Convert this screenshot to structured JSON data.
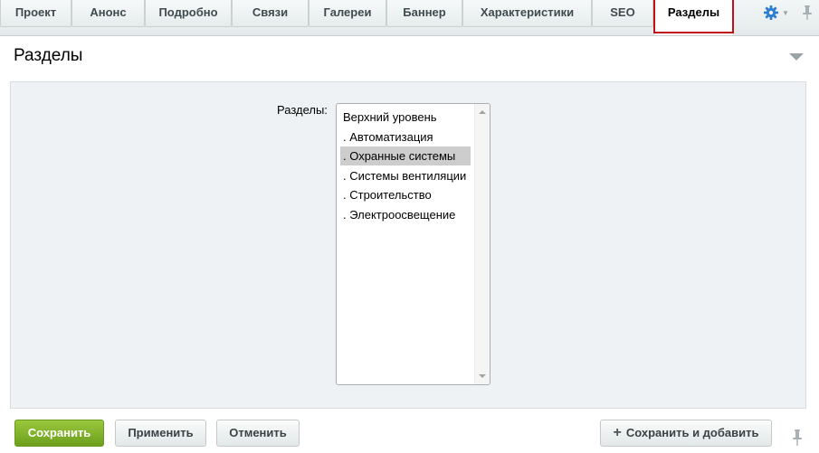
{
  "tabs": [
    {
      "label": "Проект",
      "active": false
    },
    {
      "label": "Анонс",
      "active": false
    },
    {
      "label": "Подробно",
      "active": false
    },
    {
      "label": "Связи",
      "active": false
    },
    {
      "label": "Галереи",
      "active": false
    },
    {
      "label": "Баннер",
      "active": false
    },
    {
      "label": "Характеристики",
      "active": false
    },
    {
      "label": "SEO",
      "active": false
    },
    {
      "label": "Разделы",
      "active": true
    }
  ],
  "toolbar_icons": {
    "settings": "gear-icon",
    "pin": "pin-icon",
    "settings_color": "#2f7fd0"
  },
  "section": {
    "title": "Разделы"
  },
  "form": {
    "sections_label": "Разделы:",
    "sections_options": [
      {
        "label": "Верхний уровень",
        "selected": false
      },
      {
        "label": ". Автоматизация",
        "selected": false
      },
      {
        "label": ". Охранные системы",
        "selected": true
      },
      {
        "label": ". Системы вентиляции",
        "selected": false
      },
      {
        "label": ". Строительство",
        "selected": false
      },
      {
        "label": ". Электроосвещение",
        "selected": false
      }
    ]
  },
  "buttons": {
    "save": "Сохранить",
    "apply": "Применить",
    "cancel": "Отменить",
    "save_add": "Сохранить и добавить"
  },
  "colors": {
    "primary_button": "#7fb02a",
    "active_tab_highlight": "#c01018",
    "selected_option": "#cdcdcd"
  }
}
